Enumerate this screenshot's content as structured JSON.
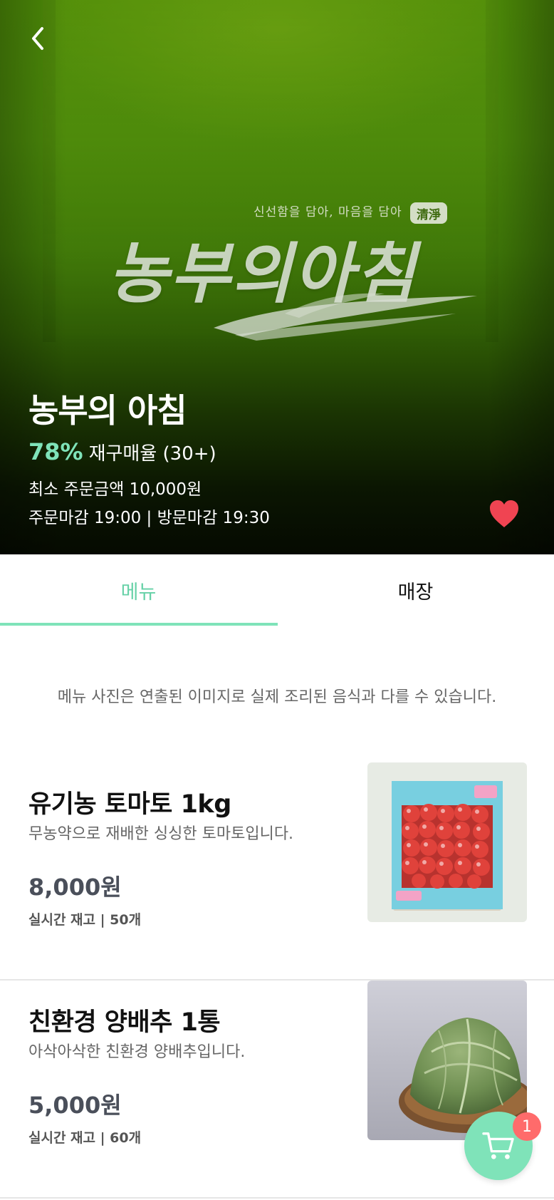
{
  "store": {
    "logo_tagline": "신선함을 담아, 마음을 담아",
    "logo_seal": "清淨",
    "logo_text": "농부의아침",
    "name": "농부의 아침",
    "reorder_rate": "78%",
    "reorder_label": "재구매율 (30+)",
    "min_order": "최소 주문금액 10,000원",
    "deadline": "주문마감 19:00 | 방문마감 19:30",
    "favorited": true
  },
  "tabs": [
    {
      "label": "메뉴",
      "active": true
    },
    {
      "label": "매장",
      "active": false
    }
  ],
  "notice": "메뉴 사진은 연출된 이미지로 실제 조리된 음식과 다를 수 있습니다.",
  "items": [
    {
      "name": "유기농 토마토 1kg",
      "description": "무농약으로 재배한 싱싱한 토마토입니다.",
      "price": "8,000원",
      "stock": "실시간 재고 | 50개",
      "image": "tomato-box"
    },
    {
      "name": "친환경 양배추 1통",
      "description": "아삭아삭한 친환경 양배추입니다.",
      "price": "5,000원",
      "stock": "실시간 재고 | 60개",
      "image": "cabbage"
    }
  ],
  "cart": {
    "count": "1"
  },
  "colors": {
    "accent": "#7fe3b9",
    "accent_text": "#66d1a7",
    "badge": "#ff6b6b",
    "heart": "#f04452"
  }
}
